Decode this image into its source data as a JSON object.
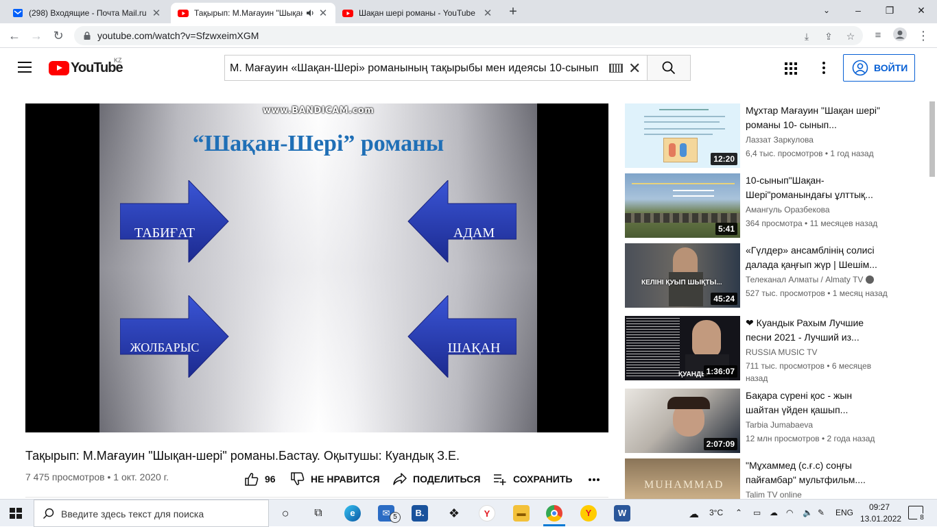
{
  "browser": {
    "tabs": [
      {
        "title": "(298) Входящие - Почта Mail.ru",
        "favicon": "mail-icon"
      },
      {
        "title": "Тақырып: М.Мағауин \"Шықан-шері\"",
        "favicon": "youtube-icon",
        "audio": "speaker-icon"
      },
      {
        "title": "Шақан шері романы - YouTube",
        "favicon": "youtube-icon"
      }
    ],
    "url": "youtube.com/watch?v=SfzwxeimXGM"
  },
  "youtube": {
    "logo_text": "YouTube",
    "country_code": "KZ",
    "search_query": "М. Мағауин «Шақан-Шері» романының тақырыбы мен идеясы 10-сынып",
    "sign_in_label": "ВОЙТИ"
  },
  "video": {
    "title": "Тақырып: М.Мағауин \"Шықан-шері\" романы.Бастау. Оқытушы: Куандық З.Е.",
    "views_date": "7 475 просмотров • 1 окт. 2020 г.",
    "likes": "96",
    "dislike_label": "НЕ НРАВИТСЯ",
    "share_label": "ПОДЕЛИТЬСЯ",
    "save_label": "СОХРАНИТЬ",
    "slide": {
      "watermark": "www.BANDICAM.com",
      "title": "“Шақан-Шері” романы",
      "boxes": [
        "ТАБИҒАТ",
        "АДАМ",
        "ЖОЛБАРЫС",
        "ШАҚАН"
      ]
    }
  },
  "recommendations": [
    {
      "title": "Мұхтар Мағауин \"Шақан шері\" романы 10- сынып...",
      "channel": "Лаззат Заркулова",
      "stats": "6,4 тыс. просмотров • 1 год назад",
      "duration": "12:20"
    },
    {
      "title": "10-сынып\"Шақан-Шері\"романындағы ұлттық...",
      "channel": "Амангуль Оразбекова",
      "stats": "364 просмотра • 11 месяцев назад",
      "duration": "5:41"
    },
    {
      "title": "«Гүлдер» ансамблінің солисі далада қаңғып жүр | Шешім...",
      "channel": "Телеканал Алматы / Almaty TV",
      "stats": "527 тыс. просмотров • 1 месяц назад",
      "duration": "45:24",
      "verified": true,
      "thumb_caption": "КЕЛІНІ ҚУЫП ШЫҚТЫ..."
    },
    {
      "title": "❤ Куандык Рахым Лучшие песни 2021 - Лучший из...",
      "channel": "RUSSIA MUSIC TV",
      "stats": "711 тыс. просмотров • 6 месяцев назад",
      "duration": "1:36:07",
      "thumb_caption": "ҚУАНДЫ"
    },
    {
      "title": "Бақара сүрені қос - жын шайтан үйден қашып...",
      "channel": "Tarbia Jumabaeva",
      "stats": "12 млн просмотров • 2 года назад",
      "duration": "2:07:09"
    },
    {
      "title": "\"Мұхаммед (с.ғ.с) соңғы пайғамбар\" мультфильм....",
      "channel": "Talim TV online",
      "stats": "",
      "duration": "",
      "thumb_caption": "MUHAMMAD"
    }
  ],
  "taskbar": {
    "search_placeholder": "Введите здесь текст для поиска",
    "mail_badge": "5",
    "temperature": "3°C",
    "language": "ENG",
    "time": "09:27",
    "date": "13.01.2022",
    "notifications": "8"
  },
  "colors": {
    "youtube_red": "#ff0000",
    "link_blue": "#065fd4",
    "slide_blue": "#1f6fb6",
    "arrow_blue": "#2a3fae"
  }
}
